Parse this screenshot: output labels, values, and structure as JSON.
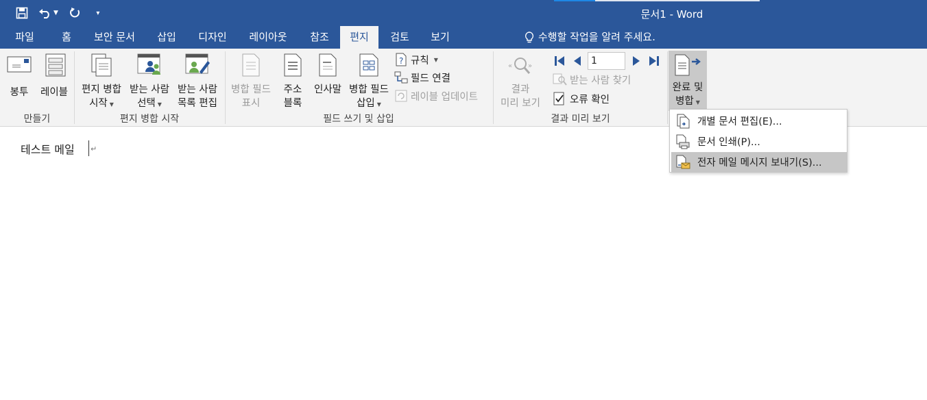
{
  "window": {
    "title": "문서1 - Word"
  },
  "qat": {
    "save_icon": "save-icon",
    "undo_icon": "undo-icon",
    "redo_icon": "repeat-icon",
    "customize_icon": "chevron-down-icon"
  },
  "tabs": [
    {
      "label": "파일"
    },
    {
      "label": "홈"
    },
    {
      "label": "보안 문서"
    },
    {
      "label": "삽입"
    },
    {
      "label": "디자인"
    },
    {
      "label": "레이아웃"
    },
    {
      "label": "참조"
    },
    {
      "label": "편지"
    },
    {
      "label": "검토"
    },
    {
      "label": "보기"
    }
  ],
  "active_tab": "편지",
  "tell_me": "수행할 작업을 알려 주세요.",
  "ribbon": {
    "create": {
      "label": "만들기",
      "envelopes": "봉투",
      "labels": "레이블"
    },
    "start": {
      "label": "편지 병합 시작",
      "start_merge_l1": "편지 병합",
      "start_merge_l2": "시작",
      "select_recipients_l1": "받는 사람",
      "select_recipients_l2": "선택",
      "edit_list_l1": "받는 사람",
      "edit_list_l2": "목록 편집"
    },
    "write": {
      "label": "필드 쓰기 및 삽입",
      "highlight_l1": "병합 필드",
      "highlight_l2": "표시",
      "address_l1": "주소",
      "address_l2": "블록",
      "greeting_l1": "인사말",
      "insert_field_l1": "병합 필드",
      "insert_field_l2": "삽입",
      "rules": "규칙",
      "match_fields": "필드 연결",
      "update_labels": "레이블 업데이트"
    },
    "preview": {
      "label": "결과 미리 보기",
      "preview_l1": "결과",
      "preview_l2": "미리 보기",
      "record_value": "1",
      "find_recipient": "받는 사람 찾기",
      "check_errors": "오류 확인"
    },
    "finish": {
      "label_l1": "완료 및",
      "label_l2": "병합"
    }
  },
  "finish_menu": [
    {
      "label": "개별 문서 편집(E)..."
    },
    {
      "label": "문서 인쇄(P)..."
    },
    {
      "label": "전자 메일 메시지 보내기(S)..."
    }
  ],
  "document": {
    "text": "테스트 메일"
  },
  "colors": {
    "accent": "#2b579a",
    "ribbon_bg": "#f3f3f3",
    "menu_hover": "#c6c6c6"
  }
}
